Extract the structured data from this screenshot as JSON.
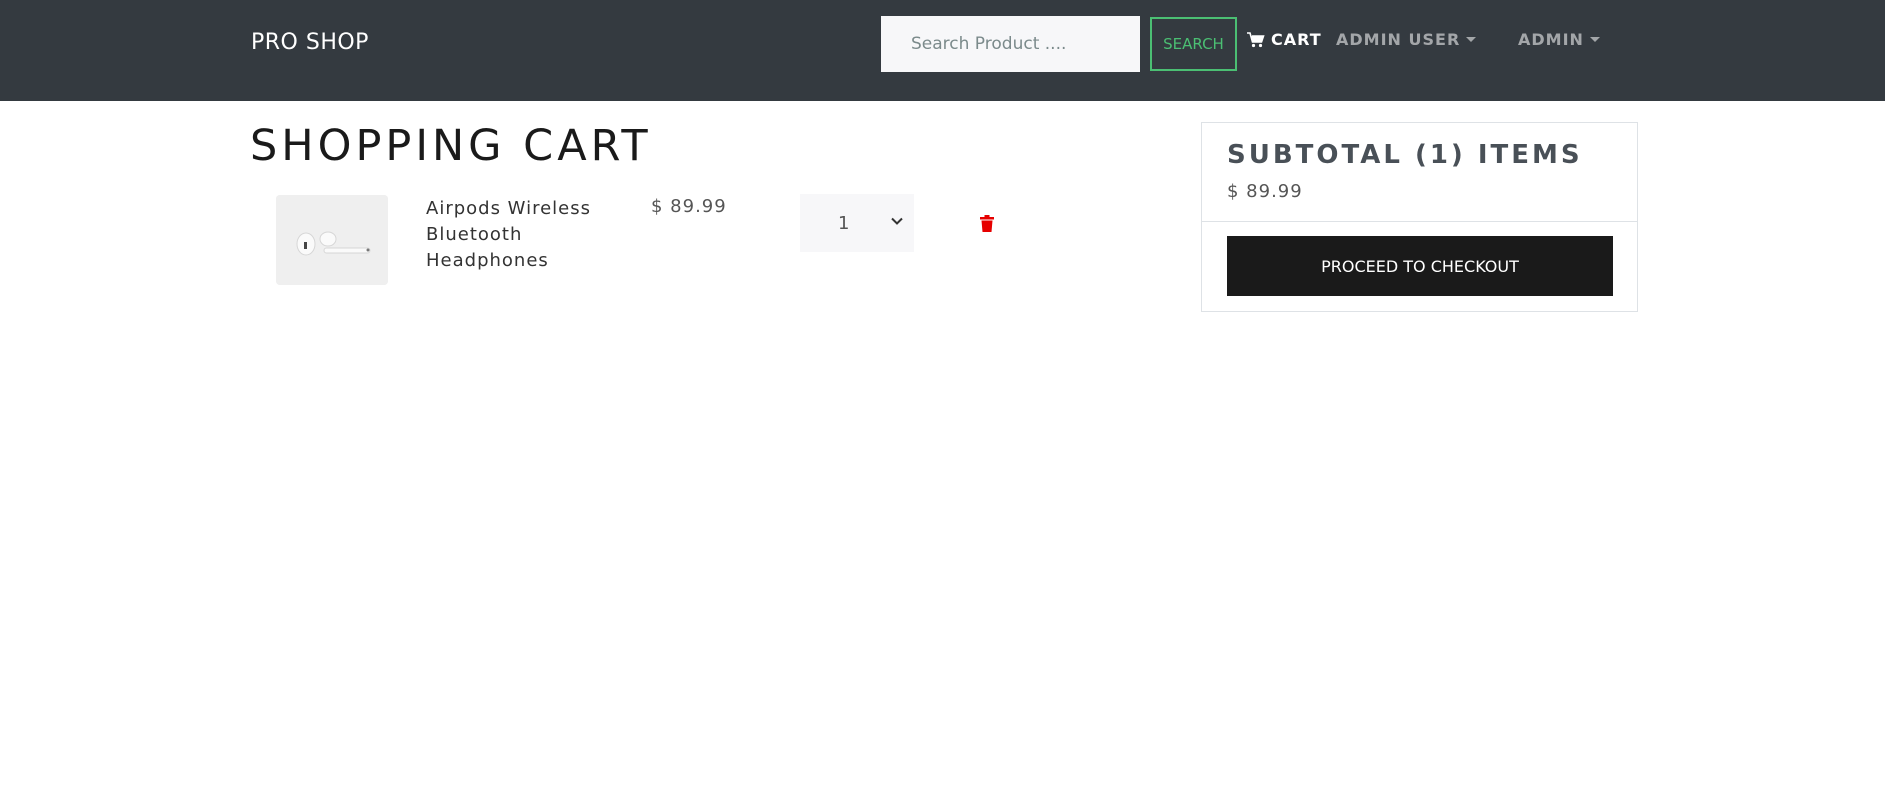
{
  "navbar": {
    "brand": "PRO SHOP",
    "search": {
      "placeholder": "Search Product ....",
      "value": ""
    },
    "search_button": "SEARCH",
    "cart_label": "CART",
    "cart_icon": "cart-icon",
    "user_menu": "ADMIN USER",
    "admin_menu": "ADMIN",
    "colors": {
      "background": "#343a40",
      "accent": "#4bbf73"
    }
  },
  "page": {
    "title": "SHOPPING CART"
  },
  "cart": {
    "items": [
      {
        "image": "airpods-image",
        "name": "Airpods Wireless Bluetooth Headphones",
        "price": "$ 89.99",
        "quantity": "1",
        "remove_icon": "trash-icon"
      }
    ]
  },
  "summary": {
    "title": "SUBTOTAL (1) ITEMS",
    "total": "$ 89.99",
    "checkout_label": "PROCEED TO CHECKOUT"
  }
}
